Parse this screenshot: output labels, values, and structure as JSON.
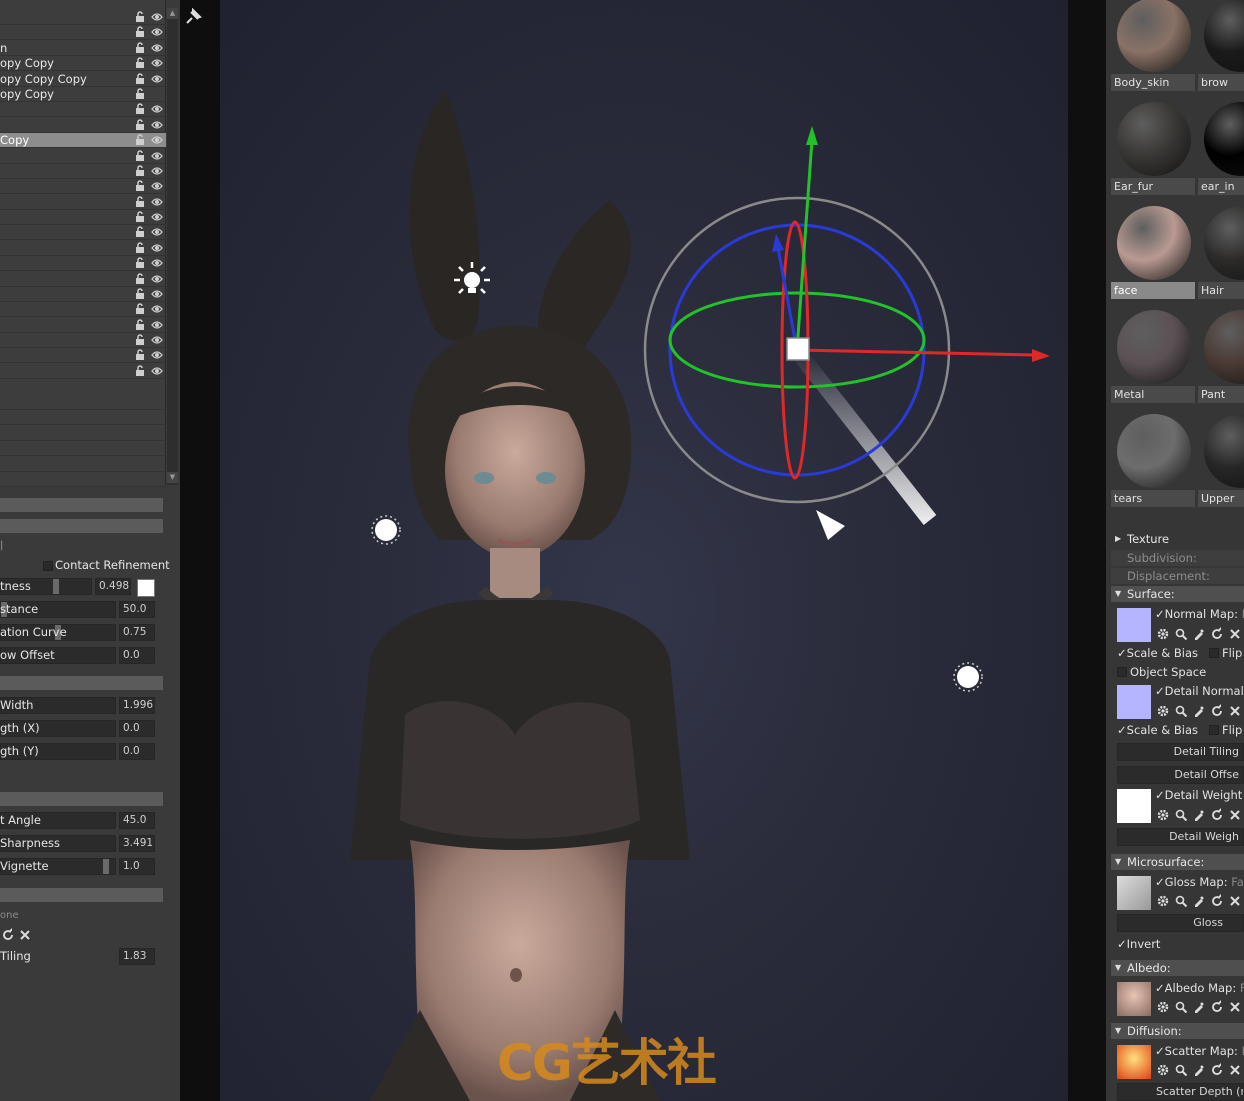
{
  "outliner": {
    "rows": [
      {
        "label": "",
        "lock": true,
        "eye": true
      },
      {
        "label": "",
        "lock": true,
        "eye": true
      },
      {
        "label": "n",
        "lock": true,
        "eye": true
      },
      {
        "label": "opy Copy",
        "lock": true,
        "eye": true
      },
      {
        "label": "opy Copy Copy",
        "lock": true,
        "eye": true
      },
      {
        "label": "opy Copy",
        "lock": true,
        "eye": false
      },
      {
        "label": "",
        "lock": true,
        "eye": true
      },
      {
        "label": "",
        "lock": true,
        "eye": true
      },
      {
        "label": " Copy",
        "lock": true,
        "eye": true,
        "selected": true
      },
      {
        "label": "",
        "lock": true,
        "eye": true
      },
      {
        "label": "",
        "lock": true,
        "eye": true
      },
      {
        "label": "",
        "lock": true,
        "eye": true
      },
      {
        "label": "",
        "lock": true,
        "eye": true
      },
      {
        "label": "",
        "lock": true,
        "eye": true
      },
      {
        "label": "",
        "lock": true,
        "eye": true
      },
      {
        "label": "",
        "lock": true,
        "eye": true
      },
      {
        "label": "",
        "lock": true,
        "eye": true
      },
      {
        "label": "",
        "lock": true,
        "eye": true
      },
      {
        "label": "",
        "lock": true,
        "eye": true
      },
      {
        "label": "",
        "lock": true,
        "eye": true
      },
      {
        "label": "",
        "lock": true,
        "eye": true
      },
      {
        "label": "",
        "lock": true,
        "eye": true
      },
      {
        "label": "",
        "lock": true,
        "eye": true
      },
      {
        "label": "",
        "lock": true,
        "eye": true
      },
      {
        "label": "",
        "lock": true,
        "eye": true
      }
    ]
  },
  "light_props": {
    "contact_refinement": "Contact Refinement",
    "rows1": [
      {
        "label": "tness",
        "value": "0.498",
        "fill": 0.498
      },
      {
        "label": "stance",
        "value": "50.0",
        "fill": 0.05
      },
      {
        "label": "ation Curve",
        "value": "0.75",
        "fill": 0.52
      },
      {
        "label": "ow Offset",
        "value": "0.0",
        "fill": 0
      }
    ],
    "rows2": [
      {
        "label": "Width",
        "value": "1.996"
      },
      {
        "label": "gth (X)",
        "value": "0.0"
      },
      {
        "label": "gth (Y)",
        "value": "0.0"
      }
    ],
    "rows3": [
      {
        "label": "t Angle",
        "value": "45.0"
      },
      {
        "label": "Sharpness",
        "value": "3.491"
      },
      {
        "label": " Vignette",
        "value": "1.0",
        "fill": 0.93
      }
    ],
    "none_text": "one",
    "tiling": {
      "label": " Tiling",
      "value": "1.83"
    }
  },
  "materials": [
    {
      "name": "Body_skin",
      "color": "#8a7266"
    },
    {
      "name": "brow",
      "color": "#1a1a1a"
    },
    {
      "name": "Ear_fur",
      "color": "#3a3835"
    },
    {
      "name": "ear_in",
      "color": "#000000"
    },
    {
      "name": "face",
      "color": "#b99a92",
      "selected": true
    },
    {
      "name": "Hair",
      "color": "#2c2b2a"
    },
    {
      "name": "Metal",
      "color": "#5b5154"
    },
    {
      "name": "Pant",
      "color": "#4a3a33"
    },
    {
      "name": "tears",
      "color": "#6d6d6d"
    },
    {
      "name": "Upper",
      "color": "#262626"
    }
  ],
  "sections": {
    "texture": "Texture",
    "subdivision": "Subdivision:",
    "displacement": "Displacement:",
    "surface": "Surface:",
    "normal_map": "Normal Map:",
    "normal_map_tail": "F",
    "scale_bias": "Scale & Bias",
    "flip": "Flip X",
    "object_space": "Object Space",
    "detail_normal": "Detail Normal M",
    "scale_bias2": "Scale & Bias",
    "flip2": "Flip X",
    "detail_tiling": "Detail Tiling",
    "detail_offset": "Detail Offse",
    "detail_weight_map": "Detail Weight M",
    "detail_weight": "Detail Weigh",
    "microsurface": "Microsurface:",
    "gloss_map": "Gloss Map:",
    "gloss_map_tail": "Fac",
    "gloss": "Gloss",
    "invert": "Invert",
    "albedo": "Albedo:",
    "albedo_map": "Albedo Map:",
    "albedo_map_tail": "Fa",
    "diffusion": "Diffusion:",
    "scatter_map": "Scatter Map:",
    "scatter_map_tail": "Fa",
    "scatter_depth": "Scatter Depth (m"
  },
  "colors": {
    "normal_map": "#b4b4ff",
    "detail_normal": "#b4b4ff",
    "gizmo_x": "#e02828",
    "gizmo_y": "#22c22a",
    "gizmo_z": "#2a3ad8"
  },
  "watermark": "CG艺术社"
}
